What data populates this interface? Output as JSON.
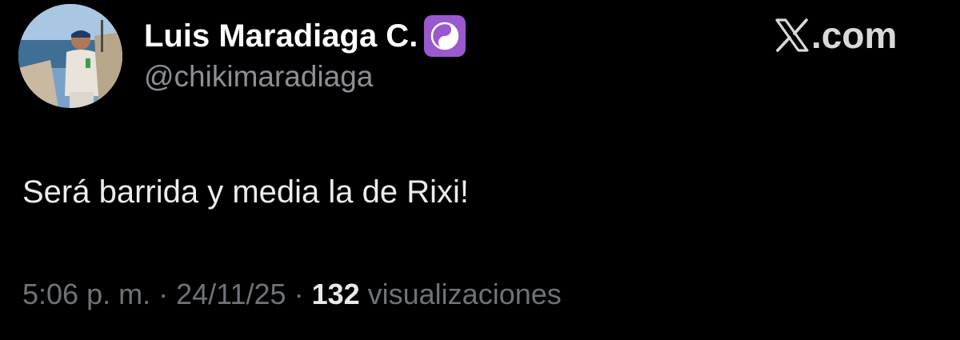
{
  "user": {
    "display_name": "Luis Maradiaga C.",
    "handle": "@chikimaradiaga",
    "avatar_icon": "profile-photo",
    "badge_icon": "yin-yang-icon",
    "badge_color": "#9b59d0"
  },
  "brand": {
    "logo_icon": "x-logo-icon",
    "text": ".com"
  },
  "tweet": {
    "text": "Será barrida y media la de Rixi!"
  },
  "meta": {
    "time": "5:06 p. m.",
    "separator": "·",
    "date": "24/11/25",
    "views_count": "132",
    "views_label": "visualizaciones"
  },
  "colors": {
    "background": "#000000",
    "primary_text": "#e7e9ea",
    "secondary_text": "#8b8f94"
  }
}
